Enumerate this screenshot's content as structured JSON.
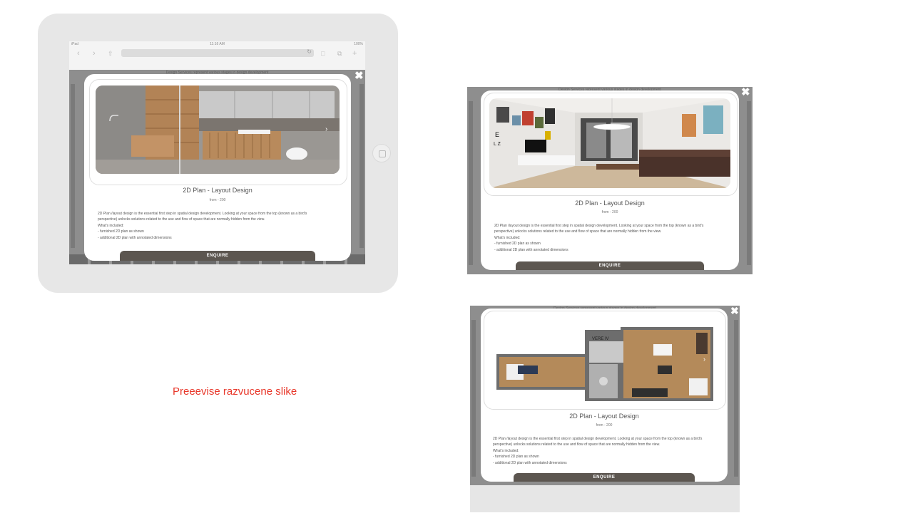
{
  "ipad": {
    "status_carrier": "iPad",
    "status_time": "11:16 AM",
    "status_battery": "100%",
    "back_icon": "chevron-left-icon",
    "forward_icon": "chevron-right-icon",
    "share_icon": "share-icon",
    "reload_icon": "reload-icon",
    "reader_icon": "book-icon",
    "tabs_icon": "tabs-icon",
    "add_icon": "plus-icon"
  },
  "site": {
    "background_caption": "Design Services represent various stages in design development"
  },
  "modal": {
    "title": "2D Plan - Layout Design",
    "price": "from - 200",
    "description": [
      "2D Plan /layout design is the essential first step in spatial design development. Looking at your space from the top (known as a bird's",
      "perspective) unlocks solutions related to the use and flow of space that are normally hidden from the view.",
      "What's included:",
      "- furnished 2D plan as shown",
      "- additional 2D plan with annotated dimensions"
    ],
    "enquire_label": "ENQUIRE",
    "close_icon": "close-icon",
    "next_icon": "chevron-right-icon"
  },
  "caption": "Preeevise razvucene slike",
  "colors": {
    "caption": "#e8372a",
    "enquire_button": "#5c5650",
    "overlay": "#8e8e8e"
  }
}
